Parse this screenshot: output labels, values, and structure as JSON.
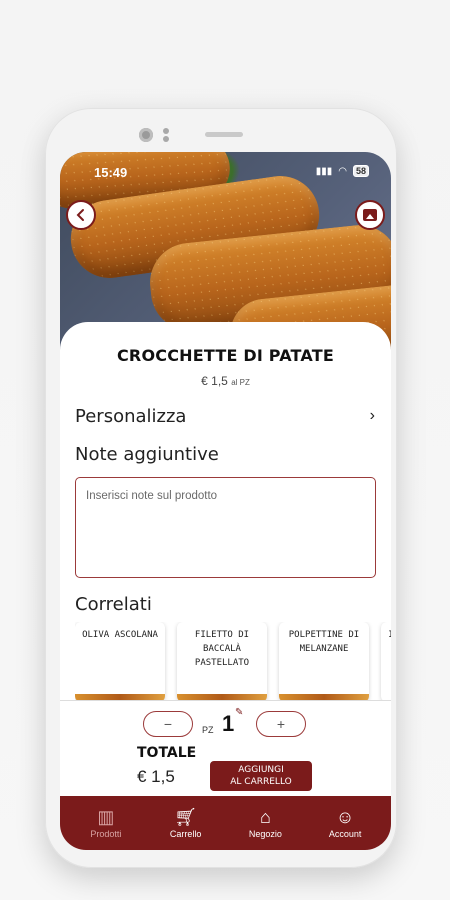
{
  "status": {
    "time": "15:49",
    "battery": "58"
  },
  "product": {
    "name": "CROCCHETTE DI PATATE",
    "price": "€ 1,5",
    "price_unit": "al PZ"
  },
  "personalizza": {
    "label": "Personalizza",
    "chevron": "›"
  },
  "notes": {
    "title": "Note aggiuntive",
    "placeholder": "Inserisci note sul prodotto"
  },
  "related": {
    "title": "Correlati",
    "items": [
      {
        "name": "OLIVA ASCOLANA"
      },
      {
        "name": "FILETTO DI BACCALÀ PASTELLATO"
      },
      {
        "name": "POLPETTINE DI MELANZANE"
      },
      {
        "name": "I"
      }
    ]
  },
  "quantity": {
    "minus": "−",
    "plus": "+",
    "unit": "PZ",
    "value": "1"
  },
  "total": {
    "label": "TOTALE",
    "value": "€ 1,5"
  },
  "add_button": {
    "line1": "AGGIUNGI",
    "line2": "AL CARRELLO"
  },
  "tabs": [
    {
      "label": "Prodotti",
      "icon": "products-icon",
      "active": true
    },
    {
      "label": "Carrello",
      "icon": "cart-icon",
      "active": false
    },
    {
      "label": "Negozio",
      "icon": "store-icon",
      "active": false
    },
    {
      "label": "Account",
      "icon": "account-icon",
      "active": false
    }
  ],
  "colors": {
    "brand": "#7b1b1b",
    "accent_border": "#9b3a3a"
  }
}
